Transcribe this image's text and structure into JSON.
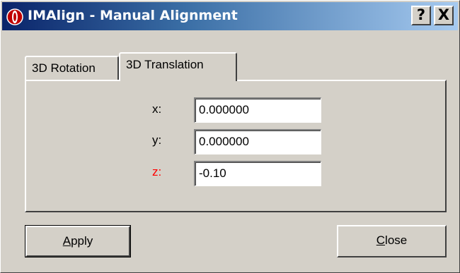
{
  "window": {
    "title": "IMAlign - Manual Alignment",
    "help_button": "?",
    "close_button": "X"
  },
  "tabs": [
    {
      "label": "3D Rotation",
      "selected": false
    },
    {
      "label": "3D Translation",
      "selected": true
    }
  ],
  "fields": {
    "x": {
      "label": "x:",
      "value": "0.000000"
    },
    "y": {
      "label": "y:",
      "value": "0.000000"
    },
    "z": {
      "label": "z:",
      "value": "-0.10",
      "label_color": "#ff0000"
    }
  },
  "buttons": {
    "apply": {
      "mnemonic": "A",
      "rest": "pply"
    },
    "close": {
      "mnemonic": "C",
      "rest": "lose"
    }
  },
  "colors": {
    "titlebar_start": "#0a246a",
    "titlebar_end": "#a6caf0",
    "dialog_face": "#d4d0c8",
    "highlight_label": "#ff0000"
  },
  "icons": [
    "app-logo-icon",
    "help-icon",
    "close-icon"
  ]
}
